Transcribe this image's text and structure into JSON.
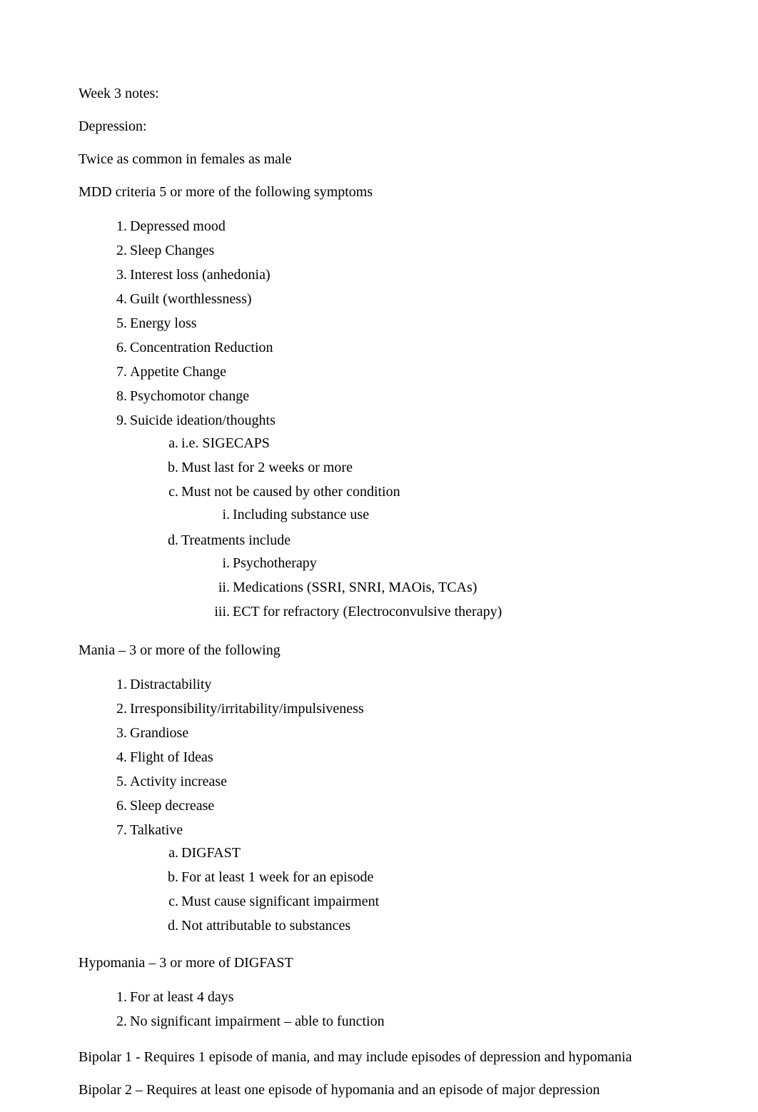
{
  "title": "Week 3 notes:",
  "depression_heading": "Depression:",
  "depression_note1": "Twice as common in females as male",
  "depression_note2": "MDD criteria 5 or more of the following symptoms",
  "mdd_items": [
    "Depressed mood",
    "Sleep Changes",
    "Interest loss (anhedonia)",
    "Guilt (worthlessness)",
    "Energy loss",
    "Concentration Reduction",
    "Appetite Change",
    "Psychomotor change",
    "Suicide ideation/thoughts"
  ],
  "mdd_sub_a": "i.e. SIGECAPS",
  "mdd_sub_b": "Must last for 2 weeks or more",
  "mdd_sub_c": "Must not be caused by other condition",
  "mdd_sub_c_i": "Including substance use",
  "mdd_sub_d": "Treatments include",
  "mdd_sub_d_i": "Psychotherapy",
  "mdd_sub_d_ii": "Medications (SSRI, SNRI, MAOis, TCAs)",
  "mdd_sub_d_iii": "ECT for refractory (Electroconvulsive therapy)",
  "mania_heading": "Mania – 3 or more of the following",
  "mania_items": [
    "Distractability",
    "Irresponsibility/irritability/impulsiveness",
    "Grandiose",
    "Flight of Ideas",
    "Activity increase",
    "Sleep decrease",
    "Talkative"
  ],
  "mania_sub_a": "DIGFAST",
  "mania_sub_b": "For at least 1 week for an episode",
  "mania_sub_c": "Must cause significant impairment",
  "mania_sub_d": "Not attributable to substances",
  "hypomania_heading": "Hypomania – 3 or more of DIGFAST",
  "hypomania_items": [
    "For at least 4 days",
    "No significant impairment – able to function"
  ],
  "bipolar1": "Bipolar 1 - Requires 1 episode of mania, and may include episodes of depression and hypomania",
  "bipolar2": "Bipolar 2 – Requires at least one episode of hypomania  and an episode of major depression"
}
